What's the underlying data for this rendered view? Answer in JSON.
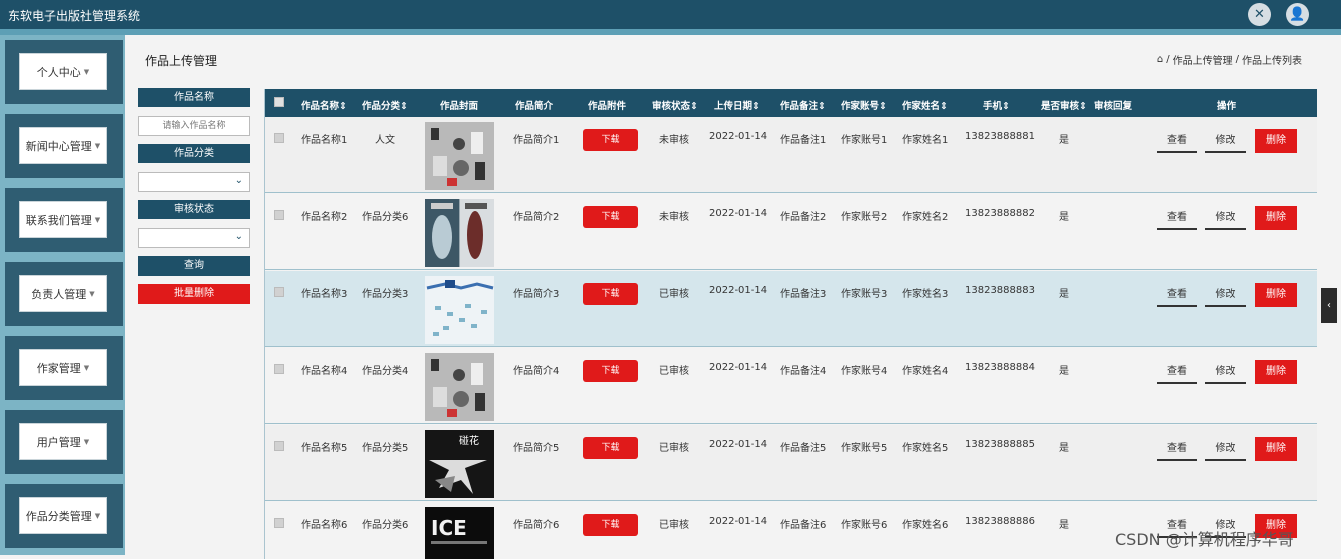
{
  "app": {
    "title": "东软电子出版社管理系统"
  },
  "topbar": {
    "icons": [
      "expand-icon",
      "user-icon"
    ],
    "expand_glyph": "✕",
    "user_glyph": "👤"
  },
  "sidebar": {
    "items": [
      {
        "label": "个人中心"
      },
      {
        "label": "新闻中心管理"
      },
      {
        "label": "联系我们管理"
      },
      {
        "label": "负责人管理"
      },
      {
        "label": "作家管理"
      },
      {
        "label": "用户管理"
      },
      {
        "label": "作品分类管理"
      }
    ],
    "arrow": "▼"
  },
  "page": {
    "title": "作品上传管理",
    "breadcrumb": {
      "home_icon": "⌂",
      "sep": "/",
      "level1": "作品上传管理",
      "level2": "作品上传列表"
    }
  },
  "filters": {
    "name_label": "作品名称",
    "name_placeholder": "请输入作品名称",
    "category_label": "作品分类",
    "category_value": "",
    "status_label": "审核状态",
    "status_value": "",
    "search_button": "查询",
    "batch_delete_button": "批量删除",
    "select_arrow": "⌄"
  },
  "table": {
    "headers": {
      "name": "作品名称",
      "category": "作品分类",
      "cover": "作品封面",
      "intro": "作品简介",
      "attachment": "作品附件",
      "status": "审核状态",
      "date": "上传日期",
      "remark": "作品备注",
      "account": "作家账号",
      "author": "作家姓名",
      "phone": "手机",
      "audited": "是否审核",
      "reply": "审核回复",
      "actions": "操作"
    },
    "sort_glyph": "⇕",
    "download_label": "下载",
    "view_label": "查看",
    "edit_label": "修改",
    "delete_label": "删除",
    "rows": [
      {
        "name": "作品名称1",
        "category": "人文",
        "intro": "作品简介1",
        "status": "未审核",
        "date": "2022-01-14",
        "remark": "作品备注1",
        "account": "作家账号1",
        "author": "作家姓名1",
        "phone": "13823888881",
        "audited": "是",
        "reply": ""
      },
      {
        "name": "作品名称2",
        "category": "作品分类6",
        "intro": "作品简介2",
        "status": "未审核",
        "date": "2022-01-14",
        "remark": "作品备注2",
        "account": "作家账号2",
        "author": "作家姓名2",
        "phone": "13823888882",
        "audited": "是",
        "reply": ""
      },
      {
        "name": "作品名称3",
        "category": "作品分类3",
        "intro": "作品简介3",
        "status": "已审核",
        "date": "2022-01-14",
        "remark": "作品备注3",
        "account": "作家账号3",
        "author": "作家姓名3",
        "phone": "13823888883",
        "audited": "是",
        "reply": ""
      },
      {
        "name": "作品名称4",
        "category": "作品分类4",
        "intro": "作品简介4",
        "status": "已审核",
        "date": "2022-01-14",
        "remark": "作品备注4",
        "account": "作家账号4",
        "author": "作家姓名4",
        "phone": "13823888884",
        "audited": "是",
        "reply": ""
      },
      {
        "name": "作品名称5",
        "category": "作品分类5",
        "intro": "作品简介5",
        "status": "已审核",
        "date": "2022-01-14",
        "remark": "作品备注5",
        "account": "作家账号5",
        "author": "作家姓名5",
        "phone": "13823888885",
        "audited": "是",
        "reply": ""
      },
      {
        "name": "作品名称6",
        "category": "作品分类6",
        "intro": "作品简介6",
        "status": "已审核",
        "date": "2022-01-14",
        "remark": "作品备注6",
        "account": "作家账号6",
        "author": "作家姓名6",
        "phone": "13823888886",
        "audited": "是",
        "reply": ""
      }
    ]
  },
  "covers": {
    "cover5_text": "碰花",
    "cover6_text": "ICE"
  },
  "colors": {
    "header": "#1e5068",
    "danger": "#e01a1a",
    "sidebar": "#7cb4c5",
    "highlight_row": "#d5e6ec"
  },
  "watermark": "CSDN @计算机程序华哥",
  "right_tab_glyph": "‹"
}
